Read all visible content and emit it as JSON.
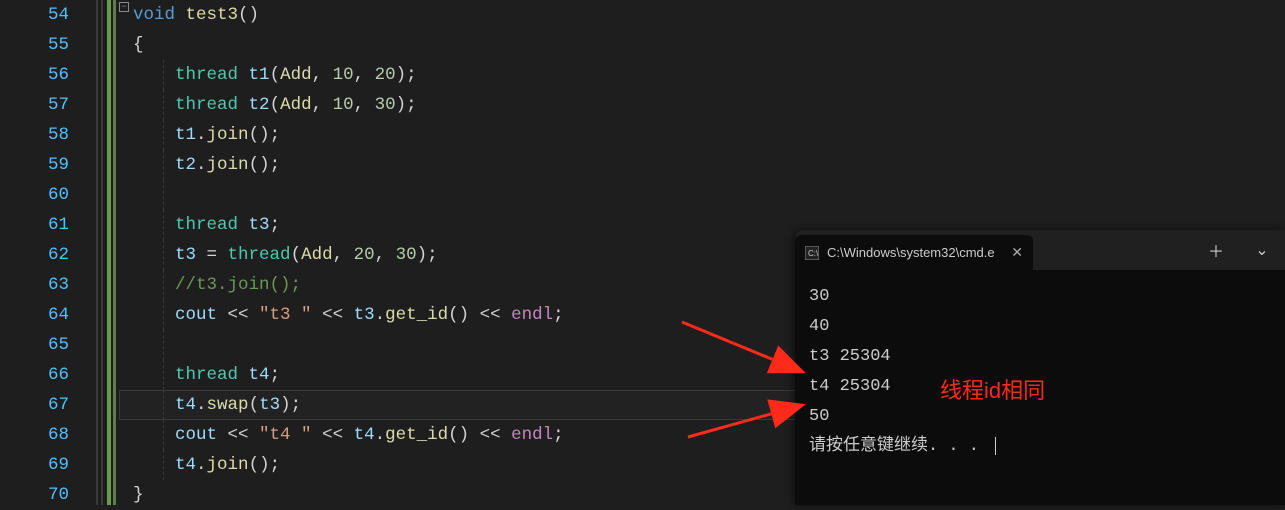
{
  "editor": {
    "line_numbers": [
      "54",
      "55",
      "56",
      "57",
      "58",
      "59",
      "60",
      "61",
      "62",
      "63",
      "64",
      "65",
      "66",
      "67",
      "68",
      "69",
      "70"
    ],
    "highlighted_line_index": 13,
    "lines": [
      [
        {
          "t": "void",
          "c": "kw"
        },
        {
          "t": " ",
          "c": "op"
        },
        {
          "t": "test3",
          "c": "fn"
        },
        {
          "t": "()",
          "c": "punc"
        }
      ],
      [
        {
          "t": "{",
          "c": "punc"
        }
      ],
      [
        {
          "t": "    ",
          "c": "op"
        },
        {
          "t": "thread",
          "c": "typ"
        },
        {
          "t": " ",
          "c": "op"
        },
        {
          "t": "t1",
          "c": "id"
        },
        {
          "t": "(",
          "c": "punc"
        },
        {
          "t": "Add",
          "c": "fn"
        },
        {
          "t": ", ",
          "c": "punc"
        },
        {
          "t": "10",
          "c": "num"
        },
        {
          "t": ", ",
          "c": "punc"
        },
        {
          "t": "20",
          "c": "num"
        },
        {
          "t": ");",
          "c": "punc"
        }
      ],
      [
        {
          "t": "    ",
          "c": "op"
        },
        {
          "t": "thread",
          "c": "typ"
        },
        {
          "t": " ",
          "c": "op"
        },
        {
          "t": "t2",
          "c": "id"
        },
        {
          "t": "(",
          "c": "punc"
        },
        {
          "t": "Add",
          "c": "fn"
        },
        {
          "t": ", ",
          "c": "punc"
        },
        {
          "t": "10",
          "c": "num"
        },
        {
          "t": ", ",
          "c": "punc"
        },
        {
          "t": "30",
          "c": "num"
        },
        {
          "t": ");",
          "c": "punc"
        }
      ],
      [
        {
          "t": "    ",
          "c": "op"
        },
        {
          "t": "t1",
          "c": "id"
        },
        {
          "t": ".",
          "c": "punc"
        },
        {
          "t": "join",
          "c": "fn"
        },
        {
          "t": "();",
          "c": "punc"
        }
      ],
      [
        {
          "t": "    ",
          "c": "op"
        },
        {
          "t": "t2",
          "c": "id"
        },
        {
          "t": ".",
          "c": "punc"
        },
        {
          "t": "join",
          "c": "fn"
        },
        {
          "t": "();",
          "c": "punc"
        }
      ],
      [],
      [
        {
          "t": "    ",
          "c": "op"
        },
        {
          "t": "thread",
          "c": "typ"
        },
        {
          "t": " ",
          "c": "op"
        },
        {
          "t": "t3",
          "c": "id"
        },
        {
          "t": ";",
          "c": "punc"
        }
      ],
      [
        {
          "t": "    ",
          "c": "op"
        },
        {
          "t": "t3",
          "c": "id"
        },
        {
          "t": " = ",
          "c": "op"
        },
        {
          "t": "thread",
          "c": "typ"
        },
        {
          "t": "(",
          "c": "punc"
        },
        {
          "t": "Add",
          "c": "fn"
        },
        {
          "t": ", ",
          "c": "punc"
        },
        {
          "t": "20",
          "c": "num"
        },
        {
          "t": ", ",
          "c": "punc"
        },
        {
          "t": "30",
          "c": "num"
        },
        {
          "t": ");",
          "c": "punc"
        }
      ],
      [
        {
          "t": "    ",
          "c": "op"
        },
        {
          "t": "//t3.join();",
          "c": "cmt"
        }
      ],
      [
        {
          "t": "    ",
          "c": "op"
        },
        {
          "t": "cout",
          "c": "id"
        },
        {
          "t": " << ",
          "c": "op"
        },
        {
          "t": "\"t3 \"",
          "c": "str"
        },
        {
          "t": " << ",
          "c": "op"
        },
        {
          "t": "t3",
          "c": "id"
        },
        {
          "t": ".",
          "c": "punc"
        },
        {
          "t": "get_id",
          "c": "fn"
        },
        {
          "t": "()",
          "c": "punc"
        },
        {
          "t": " << ",
          "c": "op"
        },
        {
          "t": "endl",
          "c": "endl"
        },
        {
          "t": ";",
          "c": "punc"
        }
      ],
      [],
      [
        {
          "t": "    ",
          "c": "op"
        },
        {
          "t": "thread",
          "c": "typ"
        },
        {
          "t": " ",
          "c": "op"
        },
        {
          "t": "t4",
          "c": "id"
        },
        {
          "t": ";",
          "c": "punc"
        }
      ],
      [
        {
          "t": "    ",
          "c": "op"
        },
        {
          "t": "t4",
          "c": "id"
        },
        {
          "t": ".",
          "c": "punc"
        },
        {
          "t": "swap",
          "c": "fn"
        },
        {
          "t": "(",
          "c": "punc"
        },
        {
          "t": "t3",
          "c": "id"
        },
        {
          "t": ");",
          "c": "punc"
        }
      ],
      [
        {
          "t": "    ",
          "c": "op"
        },
        {
          "t": "cout",
          "c": "id"
        },
        {
          "t": " << ",
          "c": "op"
        },
        {
          "t": "\"t4 \"",
          "c": "str"
        },
        {
          "t": " << ",
          "c": "op"
        },
        {
          "t": "t4",
          "c": "id"
        },
        {
          "t": ".",
          "c": "punc"
        },
        {
          "t": "get_id",
          "c": "fn"
        },
        {
          "t": "()",
          "c": "punc"
        },
        {
          "t": " << ",
          "c": "op"
        },
        {
          "t": "endl",
          "c": "endl"
        },
        {
          "t": ";",
          "c": "punc"
        }
      ],
      [
        {
          "t": "    ",
          "c": "op"
        },
        {
          "t": "t4",
          "c": "id"
        },
        {
          "t": ".",
          "c": "punc"
        },
        {
          "t": "join",
          "c": "fn"
        },
        {
          "t": "();",
          "c": "punc"
        }
      ],
      [
        {
          "t": "}",
          "c": "punc"
        }
      ]
    ],
    "indent_guides": {
      "guide1_lines": [
        2,
        3,
        4,
        5,
        6,
        7,
        8,
        9,
        10,
        11,
        12,
        13,
        14,
        15
      ],
      "guide2_lines": []
    }
  },
  "terminal": {
    "tab_title": "C:\\Windows\\system32\\cmd.e",
    "close_glyph": "✕",
    "plus_glyph": "＋",
    "chevron_glyph": "⌄",
    "output": [
      "30",
      "40",
      "t3 25304",
      "t4 25304",
      "50",
      "请按任意键继续. . . "
    ]
  },
  "annotation": {
    "text": "线程id相同"
  }
}
